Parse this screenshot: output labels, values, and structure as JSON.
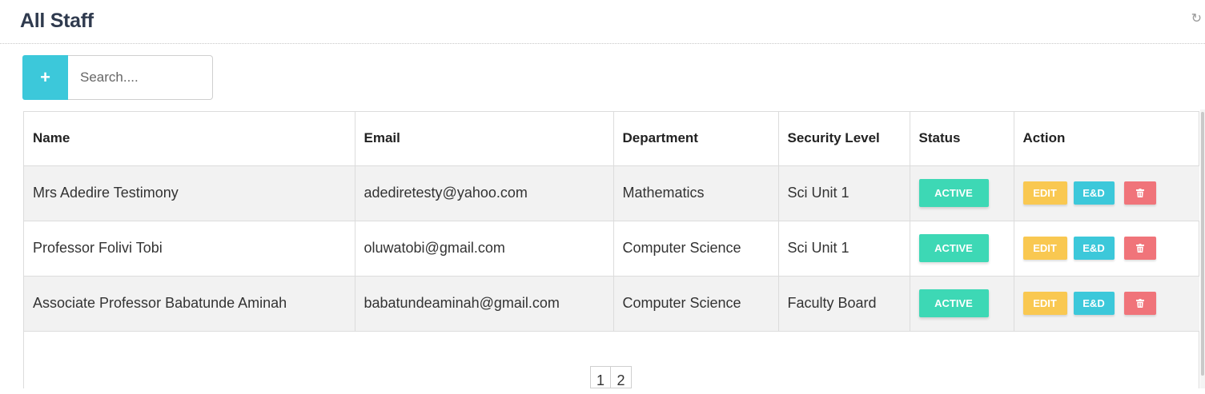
{
  "header": {
    "title": "All Staff",
    "refresh_icon": "refresh-icon"
  },
  "toolbar": {
    "add_label": "+",
    "search_placeholder": "Search...."
  },
  "table": {
    "columns": [
      "Name",
      "Email",
      "Department",
      "Security Level",
      "Status",
      "Action"
    ],
    "rows": [
      {
        "name": "Mrs Adedire Testimony",
        "email": "adediretesty@yahoo.com",
        "department": "Mathematics",
        "security_level": "Sci Unit 1",
        "status": "ACTIVE"
      },
      {
        "name": "Professor Folivi Tobi",
        "email": "oluwatobi@gmail.com",
        "department": "Computer Science",
        "security_level": "Sci Unit 1",
        "status": "ACTIVE"
      },
      {
        "name": "Associate Professor Babatunde Aminah",
        "email": "babatundeaminah@gmail.com",
        "department": "Computer Science",
        "security_level": "Faculty Board",
        "status": "ACTIVE"
      }
    ],
    "actions": {
      "edit": "EDIT",
      "edit_delete": "E&D",
      "delete_icon": "trash-icon"
    }
  },
  "pagination": {
    "pages": [
      "1",
      "2"
    ]
  },
  "colors": {
    "accent": "#3cc8da",
    "status_active": "#3dd8b5",
    "edit": "#f9c851",
    "delete": "#f0747a",
    "title": "#2f3a4e"
  }
}
